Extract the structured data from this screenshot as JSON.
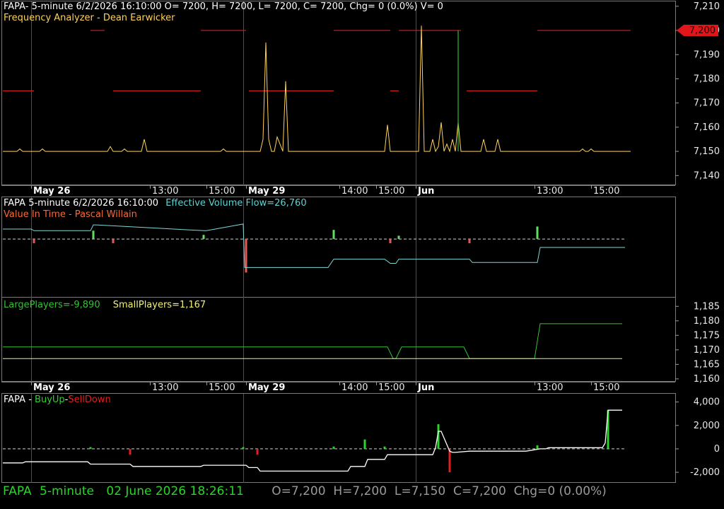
{
  "symbol": "FAPA",
  "timeframe": "5-minute",
  "date_axis": {
    "labels": [
      {
        "text": "May 26",
        "bold": true,
        "bar": 10
      },
      {
        "text": "13:00",
        "bold": false,
        "bar": 52
      },
      {
        "text": "15:00",
        "bold": false,
        "bar": 72
      },
      {
        "text": "May 29",
        "bold": true,
        "bar": 86
      },
      {
        "text": "14:00",
        "bold": false,
        "bar": 119
      },
      {
        "text": "15:00",
        "bold": false,
        "bar": 132
      },
      {
        "text": "Jun",
        "bold": true,
        "bar": 146
      },
      {
        "text": "13:00",
        "bold": false,
        "bar": 188
      },
      {
        "text": "15:00",
        "bold": false,
        "bar": 208
      }
    ],
    "day_separators_bar": [
      10,
      85,
      146
    ]
  },
  "panel1": {
    "header": "FAPA- 5-minute 6/2/2026 16:10:00 O= 7200, H= 7200, L= 7200, C= 7200, Chg= 0 (0.0%) V= 0",
    "indicator": "Frequency Analyzer - Dean Earwicker",
    "price_label": "7,200",
    "colors": {
      "price": "#ffd257",
      "level": "#cc1f1f",
      "spike": "#2ebd2e",
      "tag": "#e0161b"
    }
  },
  "panel2": {
    "title": "FAPA 5-minute  6/2/2026 16:10:00",
    "flow_label": "Effective Volume Flow=26,760",
    "indicator": "Value In Time - Pascal Willain",
    "colors": {
      "flow": "#7fd8d8",
      "up": "#5ee05e",
      "down": "#e85656",
      "title": "#ffffff",
      "flow_text": "#5fd3d3",
      "indicator_text": "#f26a3a"
    }
  },
  "panel3": {
    "large_label": "LargePlayers=-9,890",
    "small_label": "SmallPlayers=1,167",
    "colors": {
      "large": "#34c234",
      "small": "#f0f07a"
    }
  },
  "panel4": {
    "prefix": "FAPA - ",
    "buy": "BuyUp",
    "sep": "-",
    "sell": "SellDown",
    "colors": {
      "buy": "#2ed12e",
      "sell": "#e02020",
      "line": "#ffffff"
    }
  },
  "status": {
    "symbol": "FAPA",
    "timeframe": "5-minute",
    "datetime": "02 June 2026 18:26:11",
    "ohlc": "O=7,200  H=7,200  L=7,150  C=7,200  Chg=0 (0.00%)",
    "colors": {
      "left": "#2ad42a",
      "right": "#9a9a9a"
    }
  },
  "chart_data": [
    {
      "type": "line",
      "title": "Frequency Analyzer - Dean Earwicker",
      "y_ticks": [
        7140,
        7150,
        7160,
        7170,
        7180,
        7190,
        7200,
        7210
      ],
      "ylim": [
        7136,
        7212
      ],
      "x_bars": [
        0,
        5,
        6,
        7,
        10,
        12,
        13,
        14,
        15,
        16,
        17,
        18,
        19,
        20,
        21,
        22,
        23,
        24,
        25,
        26,
        27,
        28,
        29,
        30,
        31,
        32,
        33,
        34,
        35,
        36,
        37,
        38,
        39,
        40,
        41,
        42,
        43,
        44,
        45,
        46,
        47,
        48,
        49,
        50,
        51,
        52,
        53,
        54,
        55,
        56,
        57,
        58,
        59,
        60,
        61,
        62,
        63,
        64,
        65,
        66,
        67,
        68,
        69,
        70,
        71,
        72,
        73,
        74,
        75,
        76,
        77,
        78,
        79,
        80,
        81,
        82,
        83,
        84,
        85,
        86,
        87,
        88,
        89,
        90,
        91,
        92,
        93,
        94,
        95,
        96,
        97,
        98,
        99,
        100,
        101,
        102,
        103,
        104,
        105,
        106,
        107,
        108,
        109,
        110,
        111,
        112,
        113,
        114,
        115,
        116,
        117,
        118,
        119,
        120,
        121,
        122,
        123,
        124,
        125,
        126,
        127,
        128,
        129,
        130,
        131,
        132,
        133,
        134,
        135,
        136,
        137,
        138,
        139,
        140,
        141,
        142,
        143,
        144,
        145,
        146,
        147,
        148,
        149,
        150,
        151,
        152,
        153,
        154,
        155,
        156,
        157,
        158,
        159,
        160,
        161,
        162,
        163,
        164,
        165,
        166,
        167,
        168,
        169,
        170,
        171,
        172,
        173,
        174,
        175,
        176,
        177,
        178,
        179,
        180,
        181,
        182,
        183,
        184,
        185,
        186,
        187,
        188,
        189,
        190,
        191,
        192,
        193,
        194,
        195,
        196,
        197,
        198,
        199,
        200,
        201,
        202,
        203,
        204,
        205,
        206,
        207,
        208,
        209,
        210,
        211,
        212,
        213,
        214,
        215,
        216,
        217,
        218,
        219,
        220,
        221,
        222
      ],
      "price": [
        7150,
        7150,
        7151,
        7150,
        7150,
        7150,
        7150,
        7151,
        7150,
        7150,
        7150,
        7150,
        7150,
        7150,
        7150,
        7150,
        7150,
        7150,
        7150,
        7150,
        7150,
        7150,
        7150,
        7150,
        7150,
        7150,
        7150,
        7150,
        7150,
        7150,
        7150,
        7152,
        7150,
        7150,
        7150,
        7150,
        7151,
        7150,
        7150,
        7150,
        7150,
        7150,
        7150,
        7155,
        7150,
        7150,
        7150,
        7150,
        7150,
        7150,
        7150,
        7150,
        7150,
        7150,
        7150,
        7150,
        7150,
        7150,
        7150,
        7150,
        7150,
        7150,
        7150,
        7150,
        7150,
        7150,
        7150,
        7150,
        7150,
        7150,
        7150,
        7151,
        7150,
        7150,
        7150,
        7150,
        7150,
        7150,
        7150,
        7150,
        7150,
        7150,
        7150,
        7150,
        7150,
        7155,
        7195,
        7155,
        7150,
        7150,
        7156,
        7153,
        7150,
        7179,
        7150,
        7150,
        7150,
        7150,
        7150,
        7150,
        7150,
        7150,
        7150,
        7150,
        7150,
        7150,
        7150,
        7150,
        7150,
        7150,
        7150,
        7150,
        7150,
        7150,
        7150,
        7150,
        7150,
        7150,
        7150,
        7150,
        7150,
        7150,
        7150,
        7150,
        7150,
        7150,
        7150,
        7150,
        7150,
        7161,
        7150,
        7150,
        7150,
        7150,
        7150,
        7150,
        7150,
        7150,
        7150,
        7150,
        7150,
        7202,
        7150,
        7150,
        7150,
        7155,
        7150,
        7152,
        7162,
        7150,
        7153,
        7150,
        7155,
        7150,
        7162,
        7150,
        7150,
        7150,
        7150,
        7150,
        7150,
        7150,
        7150,
        7155,
        7150,
        7150,
        7150,
        7150,
        7155,
        7150,
        7150,
        7150,
        7150,
        7150,
        7150,
        7150,
        7150,
        7150,
        7150,
        7150,
        7150,
        7150,
        7150,
        7150,
        7150,
        7150,
        7150,
        7150,
        7150,
        7150,
        7150,
        7150,
        7150,
        7150,
        7150,
        7150,
        7150,
        7150,
        7151,
        7150,
        7150,
        7151,
        7150,
        7150,
        7150,
        7150,
        7150,
        7150,
        7150,
        7150,
        7150,
        7150,
        7150,
        7150,
        7150,
        7150,
        7150,
        7150,
        7150,
        7150,
        7150,
        7150,
        7159,
        7150,
        7150
      ],
      "level_segments": [
        {
          "from": 0,
          "to": 11,
          "y": 7175
        },
        {
          "from": 31,
          "to": 36,
          "y": 7200
        },
        {
          "from": 39,
          "to": 70,
          "y": 7175
        },
        {
          "from": 70,
          "to": 86,
          "y": 7200
        },
        {
          "from": 87,
          "to": 117,
          "y": 7175
        },
        {
          "from": 117,
          "to": 137,
          "y": 7200
        },
        {
          "from": 137,
          "to": 140,
          "y": 7175
        },
        {
          "from": 140,
          "to": 162,
          "y": 7200
        },
        {
          "from": 164,
          "to": 189,
          "y": 7175
        },
        {
          "from": 189,
          "to": 222,
          "y": 7200
        }
      ],
      "spike": {
        "bar": 161,
        "from": 7150,
        "to": 7200
      }
    },
    {
      "type": "line",
      "title": "Value In Time - Pascal Willain",
      "series": [
        {
          "name": "Effective Volume Flow",
          "x": [
            0,
            10,
            11,
            31,
            32,
            33,
            71,
            72,
            85,
            85.5,
            86,
            115,
            117,
            135,
            137,
            139,
            140,
            165,
            166,
            189,
            190,
            220
          ],
          "values": [
            12,
            12,
            10,
            10,
            17,
            17,
            10,
            10,
            18,
            -34,
            -34,
            -34,
            -24,
            -24,
            -29,
            -29,
            -24,
            -24,
            -28,
            -28,
            -10,
            -10
          ]
        }
      ],
      "bars_up": [
        {
          "bar": 32,
          "v": 10
        },
        {
          "bar": 71,
          "v": 5
        },
        {
          "bar": 117,
          "v": 11
        },
        {
          "bar": 140,
          "v": 4
        },
        {
          "bar": 189,
          "v": 15
        }
      ],
      "bars_down": [
        {
          "bar": 11,
          "v": -5
        },
        {
          "bar": 39,
          "v": -5
        },
        {
          "bar": 86,
          "v": -40
        },
        {
          "bar": 137,
          "v": -5
        },
        {
          "bar": 165,
          "v": -5
        }
      ],
      "ylim": [
        -70,
        50
      ]
    },
    {
      "type": "line",
      "title": "",
      "y_ticks": [
        1160,
        1165,
        1170,
        1175,
        1180,
        1185
      ],
      "ylim": [
        1159,
        1188
      ],
      "series": [
        {
          "name": "LargePlayers",
          "x": [
            0,
            136,
            138,
            139,
            141,
            163,
            165,
            188,
            190,
            219
          ],
          "values": [
            1171,
            1171,
            1167,
            1167,
            1171,
            1171,
            1167,
            1167,
            1179,
            1179
          ]
        },
        {
          "name": "SmallPlayers",
          "x": [
            0,
            219
          ],
          "values": [
            1167,
            1167
          ]
        }
      ]
    },
    {
      "type": "line",
      "title": "FAPA - BuyUp-SellDown",
      "y_ticks": [
        -2000,
        0,
        2000,
        4000
      ],
      "ylim": [
        -2900,
        4700
      ],
      "series": [
        {
          "name": "BuyUp-SellDown",
          "x": [
            0,
            7,
            8,
            30,
            31,
            45,
            46,
            70,
            71,
            86,
            87,
            90,
            91,
            122,
            123,
            128,
            129,
            135,
            136,
            152,
            153,
            154,
            155,
            158,
            159,
            160,
            165,
            185,
            190,
            192,
            193,
            212,
            213,
            214,
            215,
            219
          ],
          "values": [
            -1200,
            -1200,
            -1100,
            -1100,
            -1300,
            -1300,
            -1500,
            -1500,
            -1400,
            -1400,
            -1600,
            -1600,
            -1900,
            -1900,
            -1500,
            -1500,
            -900,
            -900,
            -500,
            -500,
            100,
            1500,
            1500,
            -200,
            -300,
            -300,
            -200,
            -200,
            0,
            0,
            100,
            100,
            500,
            3300,
            3300,
            3300
          ]
        }
      ],
      "bars_up": [
        {
          "bar": 31,
          "v": 150
        },
        {
          "bar": 85,
          "v": 150
        },
        {
          "bar": 117,
          "v": 200
        },
        {
          "bar": 128,
          "v": 800
        },
        {
          "bar": 135,
          "v": 200
        },
        {
          "bar": 154,
          "v": 2100
        },
        {
          "bar": 189,
          "v": 300
        },
        {
          "bar": 214,
          "v": 3300
        }
      ],
      "bars_down": [
        {
          "bar": 45,
          "v": -500
        },
        {
          "bar": 90,
          "v": -500
        },
        {
          "bar": 158,
          "v": -2000
        }
      ]
    }
  ]
}
